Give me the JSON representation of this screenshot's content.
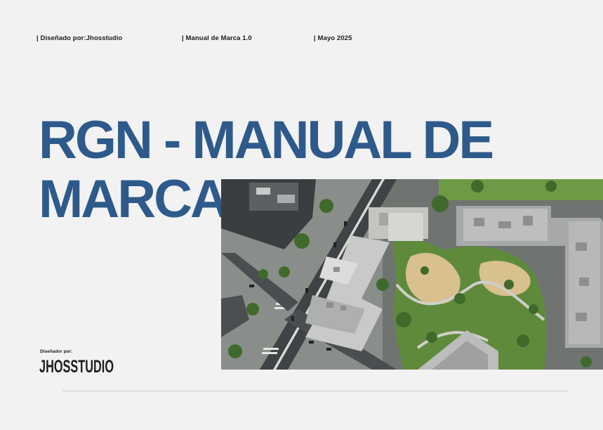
{
  "header": {
    "designer": "| Diseñado por:Jhosstudio",
    "manual": "| Manual de Marca 1.0",
    "date": "| Mayo 2025"
  },
  "title": {
    "line1": "RGN - MANUAL DE",
    "line2": "MARCA"
  },
  "credit": {
    "label": "Diseñador por:",
    "logo_text": "JHOSSTUDIO"
  },
  "colors": {
    "background": "#f2f2f2",
    "title": "#2e5a8b",
    "text": "#1c1c1c",
    "rule": "#d2d2d2"
  },
  "image": {
    "name": "aerial-city-photo"
  }
}
